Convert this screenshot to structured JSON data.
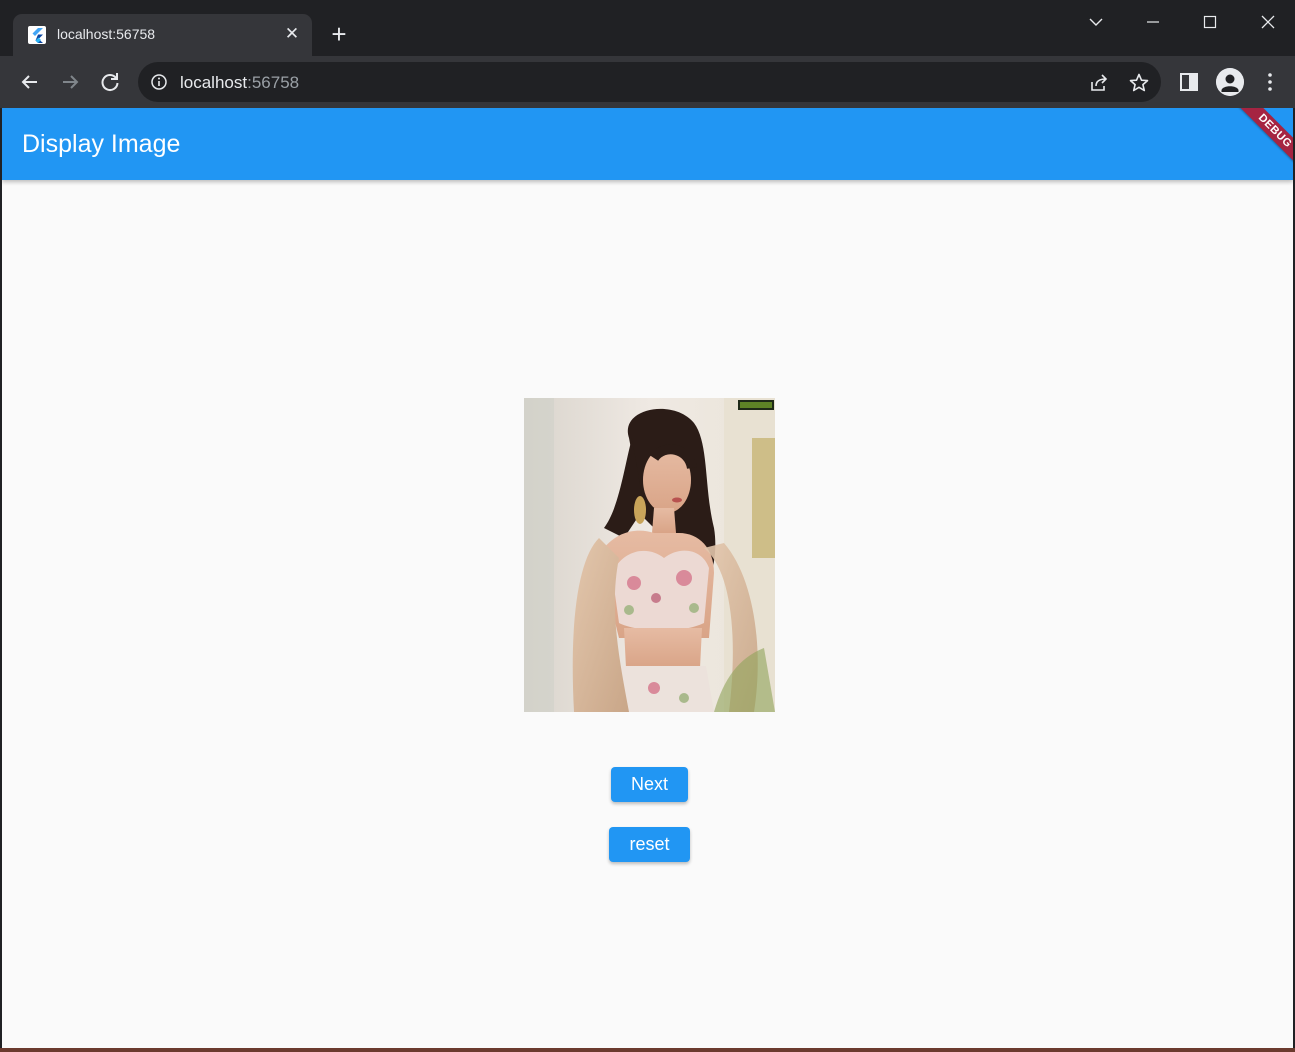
{
  "browser": {
    "tab": {
      "title": "localhost:56758",
      "favicon": "flutter-icon"
    },
    "omnibox": {
      "host": "localhost",
      "port": ":56758"
    },
    "icons": [
      "back-icon",
      "forward-icon",
      "reload-icon",
      "info-icon",
      "share-icon",
      "star-icon",
      "side-panel-icon",
      "profile-icon",
      "menu-icon"
    ]
  },
  "app": {
    "title": "Display Image",
    "debug_banner": "DEBUG",
    "accent_color": "#2196f3",
    "buttons": {
      "next": "Next",
      "reset": "reset"
    },
    "image": {
      "subject": "photo of a woman in a floral blouse"
    }
  }
}
